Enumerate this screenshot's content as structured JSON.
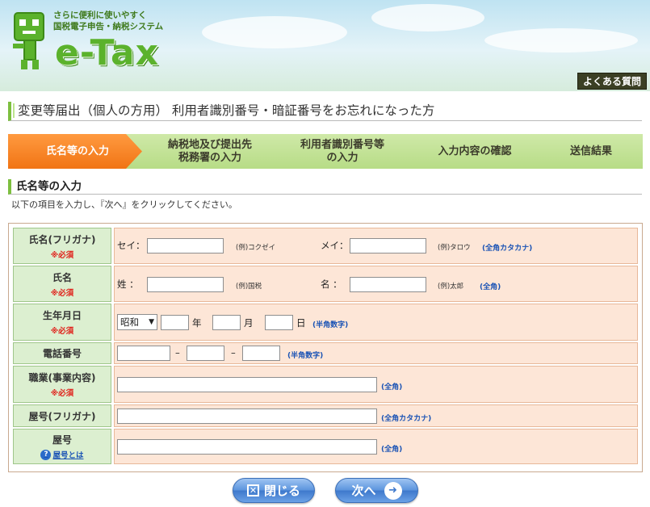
{
  "header": {
    "tagline_line1": "さらに便利に使いやすく",
    "tagline_line2": "国税電子申告・納税システム",
    "logo_text": "e-Tax",
    "faq_label": "よくある質問"
  },
  "page_title": "変更等届出（個人の方用） 利用者識別番号・暗証番号をお忘れになった方",
  "steps": [
    {
      "label": "氏名等の入力",
      "active": true
    },
    {
      "label": "納税地及び提出先\n税務署の入力",
      "active": false
    },
    {
      "label": "利用者識別番号等\nの入力",
      "active": false
    },
    {
      "label": "入力内容の確認",
      "active": false
    },
    {
      "label": "送信結果",
      "active": false
    }
  ],
  "section_title": "氏名等の入力",
  "instruction": "以下の項目を入力し、『次へ』をクリックしてください。",
  "required_mark": "※必須",
  "form": {
    "furigana": {
      "label": "氏名(フリガナ)",
      "sei_label": "セイ：",
      "sei_value": "",
      "sei_example": "(例)コクゼイ",
      "mei_label": "メイ：",
      "mei_value": "",
      "mei_example": "(例)タロウ",
      "hint": "(全角カタカナ)"
    },
    "name": {
      "label": "氏名",
      "sei_label": "姓 ：",
      "sei_value": "",
      "sei_example": "(例)国税",
      "mei_label": "名 ：",
      "mei_value": "",
      "mei_example": "(例)太郎",
      "hint": "(全角)"
    },
    "birth": {
      "label": "生年月日",
      "era_selected": "昭和",
      "year_unit": "年",
      "month_unit": "月",
      "day_unit": "日",
      "hint": "(半角数字)"
    },
    "phone": {
      "label": "電話番号",
      "separator": "–",
      "hint": "(半角数字)"
    },
    "occupation": {
      "label": "職業(事業内容)",
      "hint": "(全角)"
    },
    "shop_furigana": {
      "label": "屋号(フリガナ)",
      "hint": "(全角カタカナ)"
    },
    "shop": {
      "label": "屋号",
      "help_link": "屋号とは",
      "hint": "(全角)"
    }
  },
  "buttons": {
    "close_label": "閉じる",
    "next_label": "次へ"
  },
  "colors": {
    "active_step": "#f17414",
    "inactive_step": "#b7dc86",
    "label_bg": "#dcefd0",
    "field_bg": "#fde6d7",
    "button_blue": "#5d95de"
  }
}
